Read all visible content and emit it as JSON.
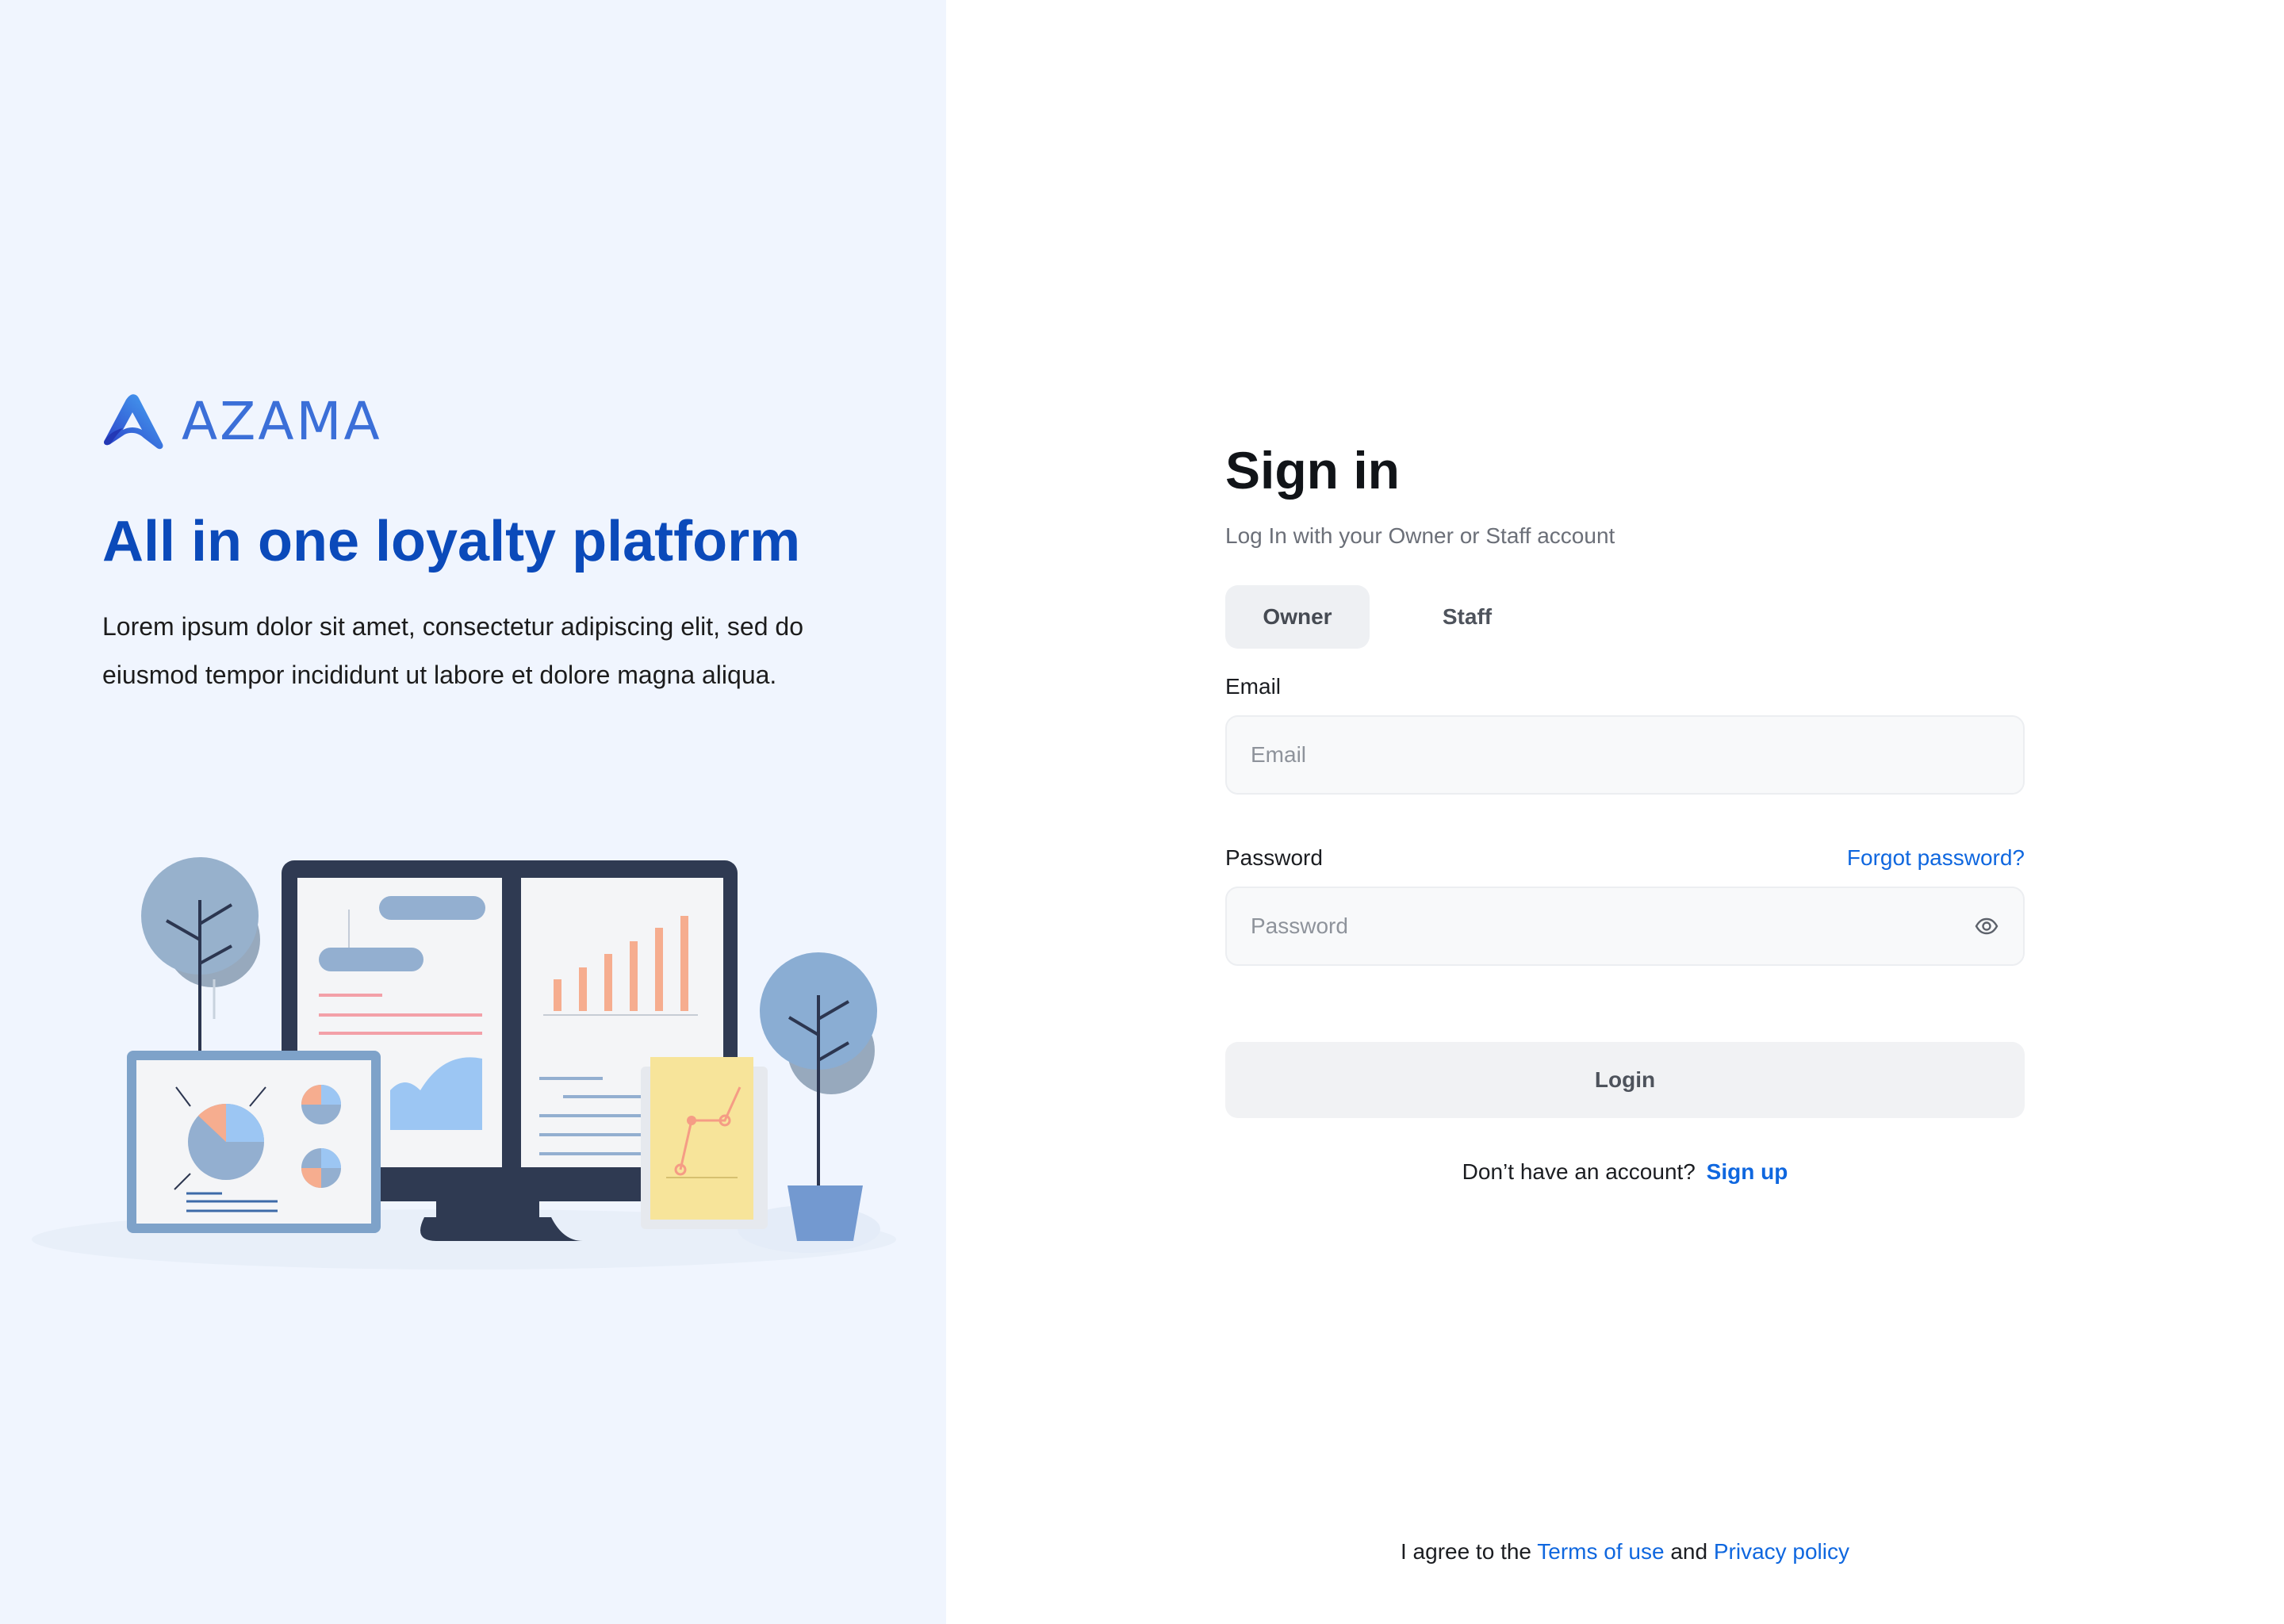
{
  "brand": {
    "name": "AZAMA",
    "tagline": "All in one loyalty platform",
    "description": "Lorem ipsum dolor sit amet, consectetur adipiscing elit, sed do eiusmod tempor incididunt ut labore et dolore magna aliqua."
  },
  "signin": {
    "title": "Sign in",
    "subtitle": "Log In with your Owner or Staff account",
    "tabs": [
      {
        "label": "Owner",
        "active": true
      },
      {
        "label": "Staff",
        "active": false
      }
    ],
    "email": {
      "label": "Email",
      "placeholder": "Email",
      "value": ""
    },
    "password": {
      "label": "Password",
      "placeholder": "Password",
      "value": "",
      "forgot_label": "Forgot password?",
      "toggle_icon": "eye-icon"
    },
    "login_label": "Login",
    "signup_prompt": "Don’t have an account?",
    "signup_label": "Sign up"
  },
  "footer": {
    "prefix": "I agree to the",
    "terms_label": "Terms of use",
    "conjunction": "and",
    "privacy_label": "Privacy policy"
  },
  "colors": {
    "left_bg": "#f0f5fe",
    "brand_blue": "#0b4aba",
    "link_blue": "#0f67df",
    "tab_active_bg": "#eef0f3",
    "button_bg": "#f1f2f4"
  }
}
